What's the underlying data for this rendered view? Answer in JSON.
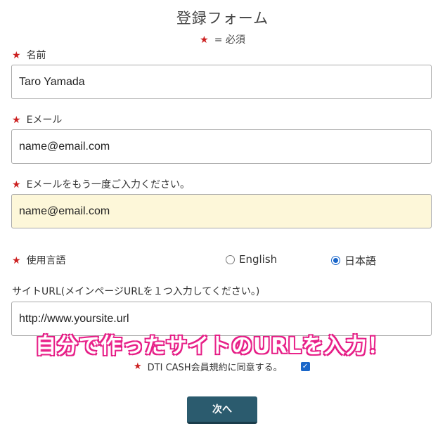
{
  "form": {
    "title": "登録フォーム",
    "required_star": "★",
    "required_note": "= 必須"
  },
  "fields": {
    "name": {
      "label": "名前",
      "value": "Taro Yamada"
    },
    "email": {
      "label": "Eメール",
      "value": "name@email.com"
    },
    "email_confirm": {
      "label": "Eメールをもう一度ご入力ください。",
      "value": "name@email.com"
    },
    "language": {
      "label": "使用言語",
      "options": [
        "English",
        "日本語"
      ],
      "selected": "日本語"
    },
    "site_url": {
      "label": "サイトURL(メインページURLを１つ入力してください。)",
      "value": "http://www.yoursite.url"
    }
  },
  "overlay": {
    "text": "自分で作ったサイトのURLを入力！"
  },
  "agreement": {
    "label": "DTI CASH会員規約に同意する。",
    "checked": true
  },
  "buttons": {
    "next_label": "次へ"
  },
  "colors": {
    "required_star": "#cc1f1f",
    "button": "#2b5b6e",
    "autofill_bg": "#fdf7d9",
    "overlay_stroke": "#e0157f",
    "accent_blue": "#1a66c9"
  }
}
